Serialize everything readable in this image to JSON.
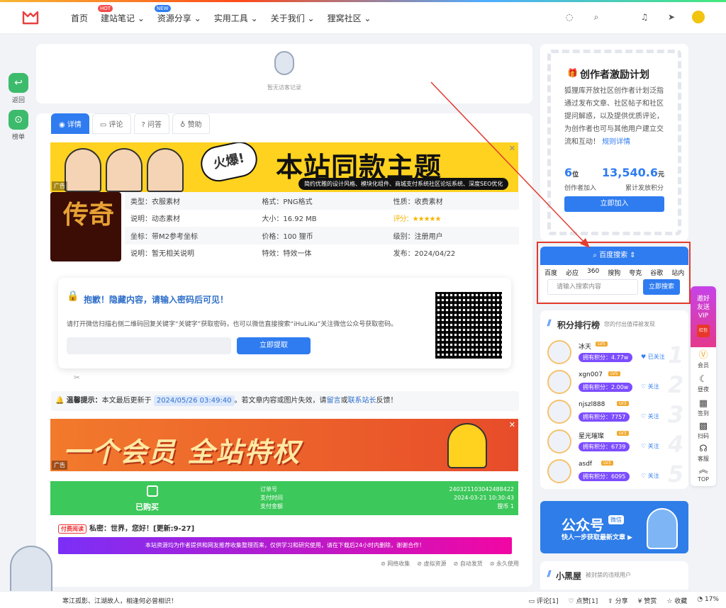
{
  "nav": {
    "items": [
      {
        "label": "首页"
      },
      {
        "label": "建站笔记",
        "badge": "HOT",
        "badge_color": "#f34b4b"
      },
      {
        "label": "资源分享",
        "badge": "NEW",
        "badge_color": "#2f7cf0"
      },
      {
        "label": "实用工具"
      },
      {
        "label": "关于我们"
      },
      {
        "label": "狸窝社区"
      }
    ]
  },
  "left_float": {
    "back": "返回",
    "rank": "榜单"
  },
  "visitor": {
    "empty": "暂无访客记录"
  },
  "tabs": [
    "详情",
    "评论",
    "问答",
    "赞助"
  ],
  "banner1": {
    "hot": "火爆!",
    "title": "本站同款主题",
    "sub": "简约优雅的设计风格、模块化组件、商城支付系统社区论坛系统、深度SEO优化",
    "ad": "广告"
  },
  "thumb_text": "传奇",
  "info": [
    [
      "类型：衣服素材",
      "格式：PNG格式",
      "性质：收费素材"
    ],
    [
      "说明：动态素材",
      "大小：16.92 MB",
      "评分：★★★★★"
    ],
    [
      "坐标：带M2参考坐标",
      "价格：100 狸币",
      "级别：注册用户"
    ],
    [
      "说明：暂无相关说明",
      "特效：特效一体",
      "发布：2024/04/22"
    ]
  ],
  "lock": {
    "title": "抱歉！隐藏内容，请输入密码后可见！",
    "desc": "请打开微信扫描右侧二维码回复关键字“关键字”获取密码，也可以微信直接搜索“iHuLiKu”关注微信公众号获取密码。",
    "button": "立即提取"
  },
  "tip": {
    "label": "温馨提示：",
    "pre": "本文最后更新于",
    "time": "2024/05/26 03:49:40",
    "mid": "。若文章内容或图片失效，请",
    "l1": "留言",
    "or": "或",
    "l2": "联系站长",
    "post": "反馈！"
  },
  "banner2": {
    "title": "一个会员 全站特权",
    "ad": "广告"
  },
  "order": {
    "status": "已购买",
    "keys": [
      "订单号",
      "支付时间",
      "支付金额"
    ],
    "values": [
      "240321103042488422",
      "2024-03-21 10:30:43",
      "狸币 1"
    ]
  },
  "paid": {
    "tag": "付费阅读",
    "text": "私密：世界，您好！[更新:9-27]"
  },
  "notice": "本站资源均为作者提供和网友推荐收集整理而来，仅供学习和研究使用，请在下载后24小时内删除，谢谢合作！",
  "foot_tags": [
    "网络收集",
    "虚拟资源",
    "自动发货",
    "永久使用"
  ],
  "bottom": {
    "msg": "寒江孤影、江湖故人，相逢何必曾相识！",
    "actions": [
      "评论[1]",
      "点赞[1]",
      "分享",
      "赞赏",
      "收藏",
      "17%"
    ]
  },
  "creator": {
    "title": "创作者激励计划",
    "desc": "狐狸库开放社区创作者计划泛指通过发布文章、社区帖子和社区提问解惑，以及提供优质评论，为创作者也可与其他用户建立交流和互动！",
    "link": "规则详情",
    "n1": "6",
    "n1u": "位",
    "n2": "13,540.6",
    "n2u": "元",
    "l1": "创作者加入",
    "l2": "累计发放积分",
    "button": "立即加入"
  },
  "search": {
    "title": "百度搜索 ⇕",
    "engines": [
      "百度",
      "必应",
      "360",
      "搜狗",
      "夸克",
      "谷歌",
      "站内"
    ],
    "placeholder": "请输入搜索内容",
    "button": "立即搜索"
  },
  "rank": {
    "title": "积分排行榜",
    "sub": "您的付出值得被发现",
    "items": [
      {
        "name": "冰天",
        "lv": "LV5",
        "pts": "拥有积分：4.77w",
        "follow": "已关注",
        "no": "1"
      },
      {
        "name": "xgn007",
        "lv": "LV5",
        "pts": "拥有积分：2.00w",
        "follow": "关注",
        "no": "2"
      },
      {
        "name": "njszl888",
        "lv": "LV3",
        "pts": "拥有积分：7757",
        "follow": "关注",
        "no": "3"
      },
      {
        "name": "星光璀璨",
        "lv": "LV3",
        "pts": "拥有积分：6739",
        "follow": "关注",
        "no": "4"
      },
      {
        "name": "asdf",
        "lv": "LV3",
        "pts": "拥有积分：6095",
        "follow": "关注",
        "no": "5"
      }
    ]
  },
  "wechat": {
    "title": "公众号",
    "tag": "微信",
    "sub": "快人一步获取最新文章 ▶"
  },
  "blackhouse": {
    "title": "小黑屋",
    "sub": "被封禁的违规用户"
  },
  "rtool": {
    "invite": "邀好友送VIP",
    "redbag": "红包",
    "items": [
      "会员",
      "昼夜",
      "签到",
      "扫码",
      "客服",
      "TOP"
    ]
  }
}
